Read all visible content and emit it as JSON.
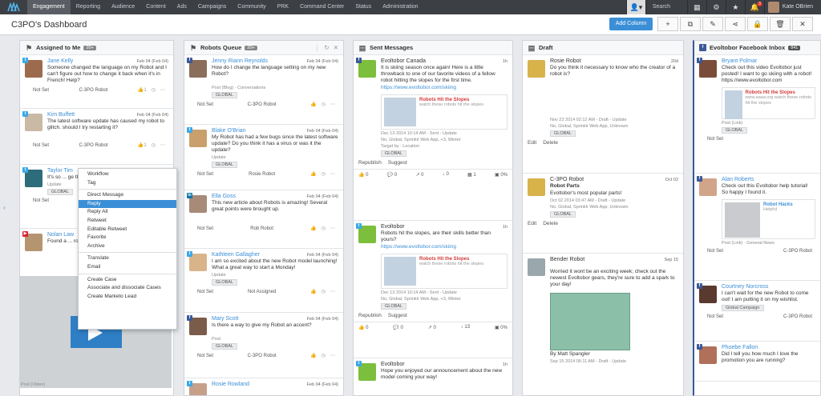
{
  "nav": {
    "tabs": [
      "Engagement",
      "Reporting",
      "Audience",
      "Content",
      "Ads",
      "Campaigns",
      "Community",
      "PRK",
      "Command Center",
      "Status",
      "Administration"
    ],
    "search": "Search",
    "user": "Kate OBrien",
    "notif_count": "3"
  },
  "toolbar": {
    "title": "C3PO's Dashboard",
    "add_column": "Add Column"
  },
  "col1": {
    "title": "Assigned to Me",
    "count": "20+",
    "cards": [
      {
        "name": "Jane Kelly",
        "date": "Feb 04 (Feb 04)",
        "text": "Someone changed the language on my Robot and I can't figure out how to change it back when it's in French! Help?",
        "status": "Not Set",
        "assignee": "C-3PO Robot",
        "likes": "1"
      },
      {
        "name": "Kim Buffett",
        "date": "Feb 04 (Feb 04)",
        "text": "The latest software update has caused my robot to glitch. should I try restarting it?",
        "status": "Not Set",
        "assignee": "C-3PO Robot",
        "likes": "1"
      },
      {
        "name": "Taylor Tim",
        "text": "It's so ... ge this",
        "meta": "Update",
        "tag": "GLOBAL",
        "status": "Not Set"
      },
      {
        "name": "Nolan Law",
        "text": "Found a ... robot on",
        "meta": "Post (Video)"
      }
    ]
  },
  "ctxmenu": {
    "items": [
      "Workflow",
      "Tag",
      "Direct Message",
      "Reply",
      "Reply All",
      "Retweet",
      "Editable Retweet",
      "Favorite",
      "Archive",
      "Translate",
      "Email",
      "Create Case",
      "Associate and dissociate Cases",
      "Create Marketo Lead"
    ]
  },
  "col2": {
    "title": "Robots Queue",
    "count": "20+",
    "cards": [
      {
        "name": "Jenny Riann Reynolds",
        "date": "Feb 04 (Feb 04)",
        "text": "How do I change the language setting on my new Robot?",
        "meta": "Post (Blog) · Conversations",
        "tag": "GLOBAL",
        "status": "Not Set",
        "assignee": "C-3PO Robot"
      },
      {
        "name": "Blake O'Brian",
        "date": "Feb 04 (Feb 04)",
        "text": "My Robot has had a few bugs since the latest software update? Do you think it has a virus or was it the update?",
        "meta": "Update",
        "tag": "GLOBAL",
        "status": "Not Set",
        "assignee": "Rosie Robot"
      },
      {
        "name": "Ella Goss",
        "date": "Feb 04 (Feb 04)",
        "text": "This new article about Robots is amazing! Several great points were brought up.",
        "status": "Not Set",
        "assignee": "Rob Robot"
      },
      {
        "name": "Kathleen Gallagher",
        "date": "Feb 04 (Feb 04)",
        "text": "I am so excited about the new Robot model launching! What a great way to start a Monday!",
        "meta": "Update",
        "tag": "GLOBAL",
        "status": "Not Set",
        "assignee": "Not Assigned"
      },
      {
        "name": "Mary Scott",
        "date": "Feb 04 (Feb 04)",
        "text": "Is there a way to give my Robot an accent?",
        "meta": "Post",
        "tag": "GLOBAL",
        "status": "Not Set",
        "assignee": "C-3PO Robot"
      },
      {
        "name": "Rosie Rowland",
        "date": "Feb 04 (Feb 04)"
      }
    ]
  },
  "col3": {
    "title": "Sent Messages",
    "cards": [
      {
        "name": "Evoltobor Canada",
        "date": "1h",
        "text": "It is skiing season once again! Here is a little throwback to one of our favorite videos of a fellow robot hitting the slopes for the first time.",
        "link": "https://www.evoltobor.com/skiing",
        "lb_title": "Robots Hit the Slopes",
        "lb_desc": "watch these robots hit the slopes",
        "meta1": "Dec 13 2014 10:14 AM - Sent - Update",
        "meta2": "No, Global, Sprinklr Web App, +3, Winter",
        "meta3": "Target by : Location",
        "tag": "GLOBAL",
        "actions": [
          "Republish",
          "Suggest"
        ],
        "eng": [
          "0",
          "0",
          "0",
          "0",
          "1",
          "0%"
        ]
      },
      {
        "name": "Evoltobor",
        "date": "1h",
        "text": "Robots hit the slopes, are their skills better than yours?",
        "link": "https://www.evoltobor.com/skiing",
        "lb_title": "Robots Hit the Slopes",
        "lb_desc": "watch these robots hit the slopes",
        "meta1": "Dec 13 2014 10:14 AM - Sent - Update",
        "meta2": "No, Global, Sprinklr Web App, +3, Winter",
        "tag": "GLOBAL",
        "actions": [
          "Republish",
          "Suggest"
        ],
        "eng": [
          "0",
          "0",
          "0",
          "13",
          "0%"
        ]
      },
      {
        "name": "Evoltobor",
        "date": "1h",
        "text": "Hope you enjoyed our announcement about the new model coming your way!"
      }
    ]
  },
  "col4": {
    "title": "Draft",
    "cards": [
      {
        "name": "Rosie Robot",
        "date": "20d",
        "text": "Do you think it necessary to know who the creator of a robot is?",
        "meta1": "Nov 23 2014 02:12 AM - Draft - Update",
        "meta2": "No, Global, Sprinklr Web App, Unknown",
        "tag": "GLOBAL",
        "actions": [
          "Edit",
          "Delete"
        ]
      },
      {
        "name": "C-3PO Robot",
        "date": "Oct 02",
        "bold": "Robot Parts",
        "text": "Evoltobor's most popular parts!",
        "meta1": "Oct 02 2014 03:47 AM - Draft - Update",
        "meta2": "No, Global, Sprinklr Web App, Unknown",
        "tag": "GLOBAL",
        "actions": [
          "Edit",
          "Delete"
        ]
      },
      {
        "name": "Bender Robot",
        "date": "Sep 15",
        "text": "Worried it wont be an exciting week; check out the newest Evoltobor gears, they're sure to add a spark to your day!",
        "caption": "By Matt Spangler",
        "meta1": "Sep 15 2014 06:11 AM - Draft - Update"
      }
    ]
  },
  "col5": {
    "title": "Evoltobor Facebook Inbox",
    "count": "841",
    "cards": [
      {
        "name": "Bryant Polmar",
        "text": "Check out this video Evoltobor just posted! I want to go skiing with a robot! https://www.evoltobor.com",
        "lb_title": "Robots Hit the Slopes",
        "lb_desc": "www.aaaa.org watch these robots hit the slopes",
        "meta": "Post (Link)",
        "tag": "GLOBAL",
        "status": "Not Set"
      },
      {
        "name": "Alan Roberts",
        "text": "Check out this Evoltobor help tutorial! So happy I found it.",
        "lb_title": "Robot Hacks",
        "lb_desc": "Helpful",
        "meta": "Post (Link) · General News",
        "status": "Not Set",
        "assignee": "C-3PO Robot"
      },
      {
        "name": "Courtney Norcross",
        "text": "I can't wait for the new Robot to come out! I am putting it on my wishlist.",
        "tag": "Global Campaign",
        "status": "Not Set",
        "assignee": "C-3PO Robot"
      },
      {
        "name": "Phoebe Fallon",
        "text": "Did I tell you how much I love the promotion you are running?"
      }
    ]
  }
}
